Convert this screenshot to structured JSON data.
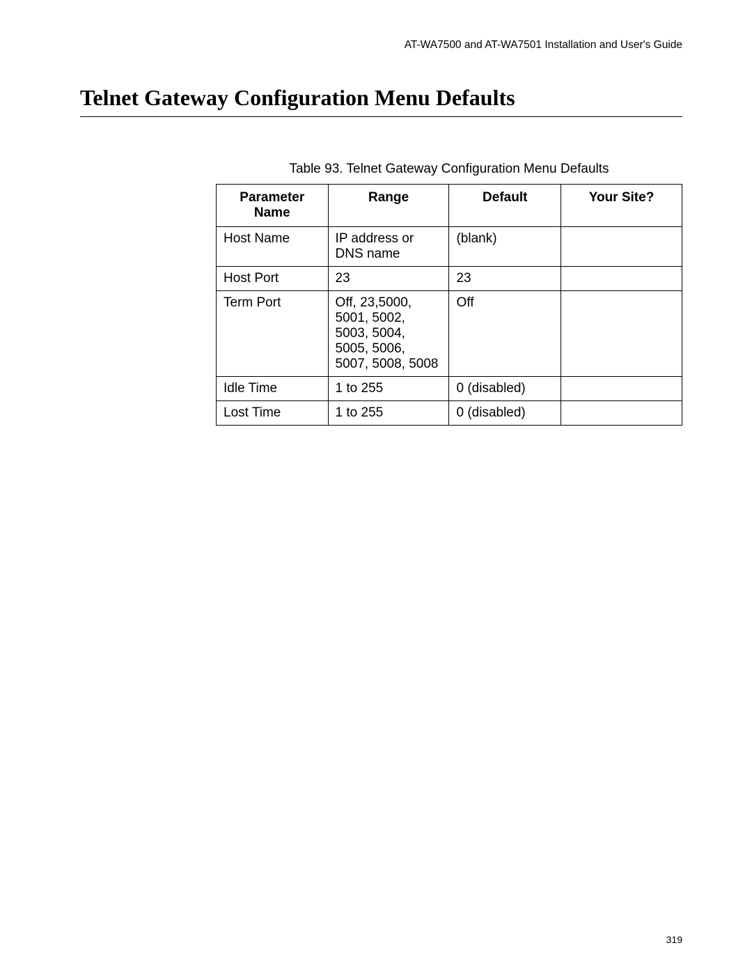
{
  "running_header": "AT-WA7500 and AT-WA7501 Installation and User's Guide",
  "section_title": "Telnet Gateway Configuration Menu Defaults",
  "table_caption": "Table 93. Telnet Gateway Configuration Menu Defaults",
  "headers": {
    "parameter": "Parameter Name",
    "range": "Range",
    "default": "Default",
    "your_site": "Your Site?"
  },
  "rows": [
    {
      "parameter": "Host Name",
      "range": "IP address or DNS name",
      "default": "(blank)",
      "your_site": ""
    },
    {
      "parameter": "Host Port",
      "range": "23",
      "default": "23",
      "your_site": ""
    },
    {
      "parameter": "Term Port",
      "range": "Off, 23,5000, 5001, 5002, 5003, 5004, 5005, 5006, 5007, 5008, 5008",
      "default": "Off",
      "your_site": ""
    },
    {
      "parameter": "Idle Time",
      "range": "1 to 255",
      "default": "0 (disabled)",
      "your_site": ""
    },
    {
      "parameter": "Lost Time",
      "range": "1 to 255",
      "default": "0 (disabled)",
      "your_site": ""
    }
  ],
  "page_number": "319"
}
